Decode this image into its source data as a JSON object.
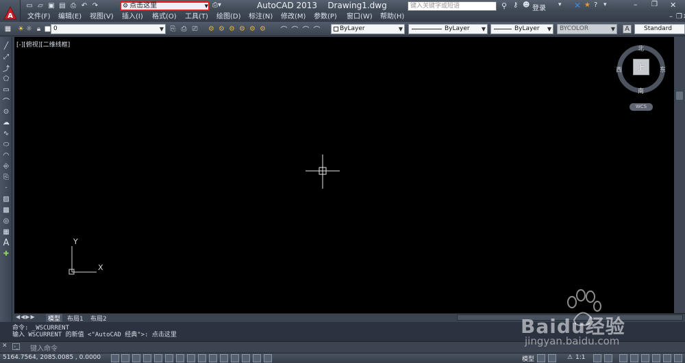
{
  "titlebar": {
    "app_title": "AutoCAD 2013",
    "doc_title": "Drawing1.dwg",
    "workspace_value": "点击这里",
    "search_placeholder": "键入关键字或短语",
    "login_label": "登录"
  },
  "menu": [
    "文件(F)",
    "编辑(E)",
    "视图(V)",
    "插入(I)",
    "格式(O)",
    "工具(T)",
    "绘图(D)",
    "标注(N)",
    "修改(M)",
    "参数(P)",
    "窗口(W)",
    "帮助(H)"
  ],
  "layers_toolbar": {
    "layer_value": "0",
    "color_value": "ByLayer",
    "linetype_value": "ByLayer",
    "lineweight_value": "ByLayer",
    "plotstyle_value": "BYCOLOR",
    "textstyle_value": "Standard"
  },
  "viewport": {
    "label": "[-][俯视][二维线框]",
    "viewcube": {
      "north": "北",
      "south": "南",
      "east": "东",
      "west": "西",
      "top": "上",
      "wcs": "WCS"
    },
    "ucs": {
      "x": "X",
      "y": "Y"
    }
  },
  "layout_tabs": [
    "模型",
    "布局1",
    "布局2"
  ],
  "command": {
    "history_line1": "命令: _WSCURRENT",
    "history_line2": "输入 WSCURRENT 的新值 <\"AutoCAD 经典\">: 点击这里",
    "prompt_placeholder": "键入命令"
  },
  "status": {
    "coordinates": "5164.7564, 2085.0085 , 0.0000",
    "model_label": "模型",
    "scale_label": "1:1"
  },
  "watermark": {
    "brand": "Baidu经验",
    "url": "jingyan.baidu.com"
  },
  "colors": {
    "canvas": "#000000",
    "chrome": "#3b4453",
    "highlight_border": "#e02020"
  }
}
